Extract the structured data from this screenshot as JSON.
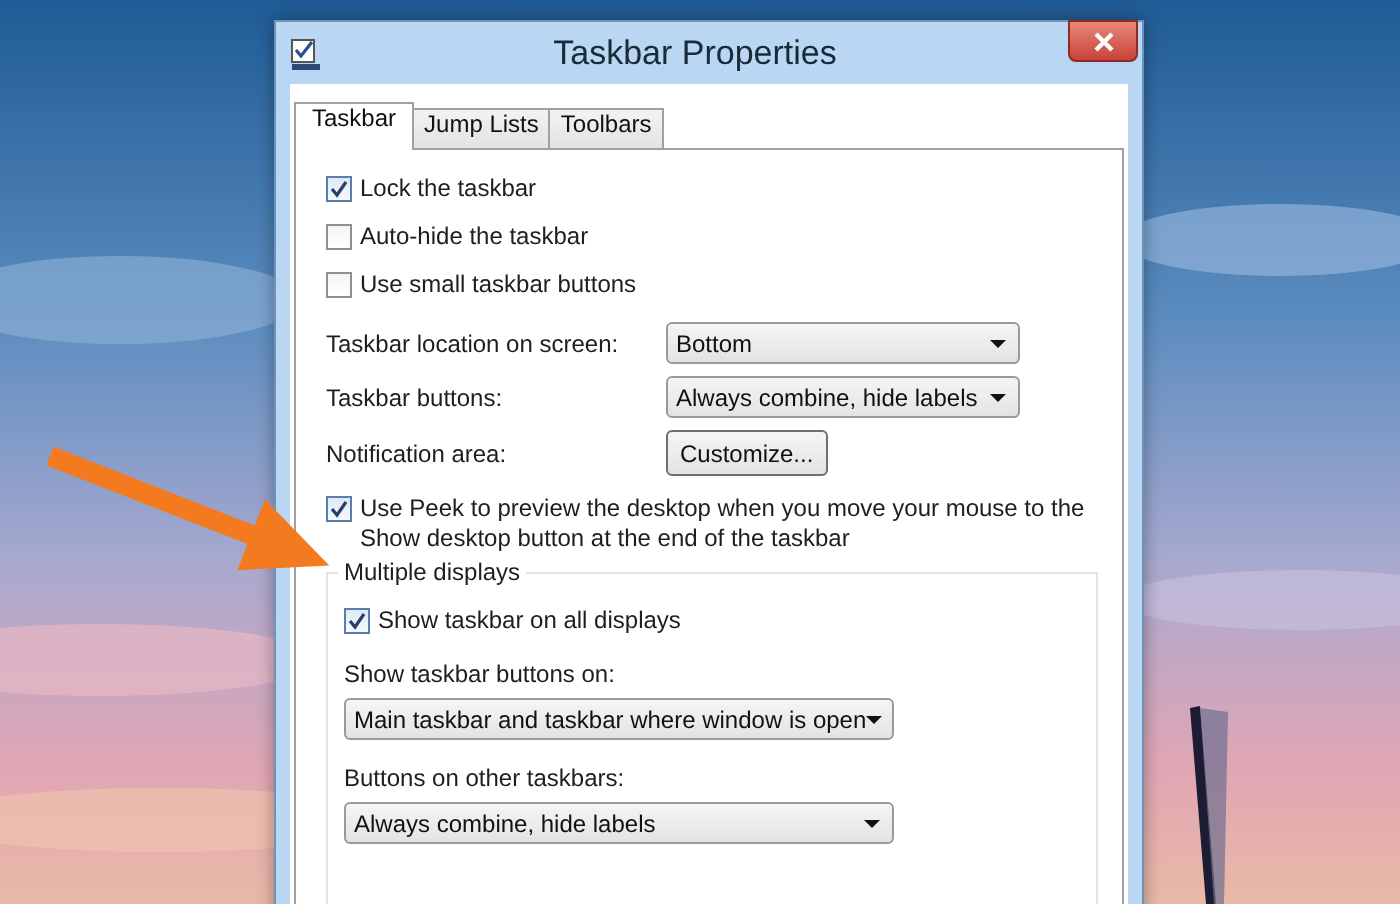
{
  "window": {
    "title": "Taskbar Properties"
  },
  "tabs": [
    {
      "label": "Taskbar",
      "selected": true
    },
    {
      "label": "Jump Lists",
      "selected": false
    },
    {
      "label": "Toolbars",
      "selected": false
    }
  ],
  "checkboxes": [
    {
      "label": "Lock the taskbar",
      "checked": true
    },
    {
      "label": "Auto-hide the taskbar",
      "checked": false
    },
    {
      "label": "Use small taskbar buttons",
      "checked": false
    }
  ],
  "settings": [
    {
      "label": "Taskbar location on screen:",
      "kind": "dropdown",
      "value": "Bottom"
    },
    {
      "label": "Taskbar buttons:",
      "kind": "dropdown",
      "value": "Always combine, hide labels"
    },
    {
      "label": "Notification area:",
      "kind": "button",
      "value": "Customize..."
    }
  ],
  "peek": {
    "label": "Use Peek to preview the desktop when you move your mouse to the Show desktop button at the end of the taskbar",
    "checked": true
  },
  "multiple_displays": {
    "title": "Multiple displays",
    "show_all": {
      "label": "Show taskbar on all displays",
      "checked": true
    },
    "fields": [
      {
        "label": "Show taskbar buttons on:",
        "value": "Main taskbar and taskbar where window is open"
      },
      {
        "label": "Buttons on other taskbars:",
        "value": "Always combine, hide labels"
      }
    ]
  }
}
